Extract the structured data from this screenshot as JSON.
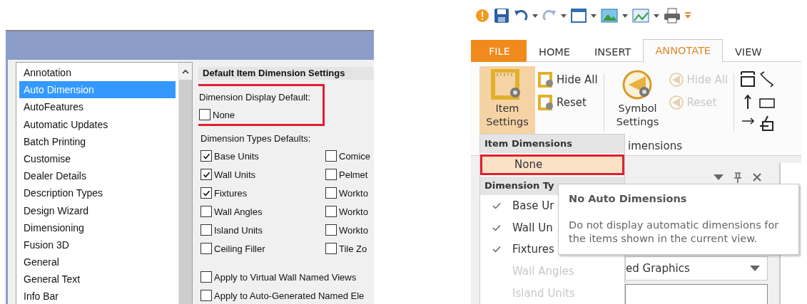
{
  "options_dialog": {
    "categories": [
      {
        "label": "Annotation",
        "selected": false
      },
      {
        "label": "Auto Dimension",
        "selected": true
      },
      {
        "label": "AutoFeatures",
        "selected": false
      },
      {
        "label": "Automatic Updates",
        "selected": false
      },
      {
        "label": "Batch Printing",
        "selected": false
      },
      {
        "label": "Customise",
        "selected": false
      },
      {
        "label": "Dealer Details",
        "selected": false
      },
      {
        "label": "Description Types",
        "selected": false
      },
      {
        "label": "Design Wizard",
        "selected": false
      },
      {
        "label": "Dimensioning",
        "selected": false
      },
      {
        "label": "Fusion 3D",
        "selected": false
      },
      {
        "label": "General",
        "selected": false
      },
      {
        "label": "General Text",
        "selected": false
      },
      {
        "label": "Info Bar",
        "selected": false
      }
    ],
    "section_title": "Default Item Dimension Settings",
    "display_default": {
      "label": "Dimension Display Default:",
      "highlighted": true,
      "option": {
        "label": "None",
        "checked": false
      }
    },
    "types_label": "Dimension Types Defaults:",
    "types": [
      {
        "label": "Base Units",
        "checked": true
      },
      {
        "label": "Comice",
        "checked": false
      },
      {
        "label": "Wall Units",
        "checked": true
      },
      {
        "label": "Pelmet",
        "checked": false
      },
      {
        "label": "Fixtures",
        "checked": true
      },
      {
        "label": "Workto",
        "checked": false
      },
      {
        "label": "Wall Angles",
        "checked": false
      },
      {
        "label": "Workto",
        "checked": false
      },
      {
        "label": "Island Units",
        "checked": false
      },
      {
        "label": "Workto",
        "checked": false
      },
      {
        "label": "Ceiling Filler",
        "checked": false
      },
      {
        "label": "Tile Zo",
        "checked": false
      }
    ],
    "apply_options": [
      {
        "label": "Apply to Virtual Wall Named Views",
        "checked": false
      },
      {
        "label": "Apply to Auto-Generated Named Ele",
        "checked": false
      }
    ]
  },
  "ribbon": {
    "tabs": [
      {
        "label": "FILE",
        "kind": "file",
        "selected": false
      },
      {
        "label": "HOME",
        "kind": "tab",
        "selected": false
      },
      {
        "label": "INSERT",
        "kind": "tab",
        "selected": false
      },
      {
        "label": "ANNOTATE",
        "kind": "tab",
        "selected": true
      },
      {
        "label": "VIEW",
        "kind": "tab",
        "selected": false
      }
    ],
    "item_settings": {
      "label": "Item Settings",
      "active": true
    },
    "item_buttons": [
      {
        "label": "Hide All",
        "disabled": false
      },
      {
        "label": "Reset",
        "disabled": false
      }
    ],
    "symbol_settings": {
      "label": "Symbol Settings",
      "active": false
    },
    "symbol_buttons": [
      {
        "label": "Hide All",
        "disabled": true
      },
      {
        "label": "Reset",
        "disabled": true
      }
    ],
    "group_label": "imensions",
    "menu": [
      {
        "kind": "header",
        "label": "Item Dimensions"
      },
      {
        "kind": "item",
        "label": "None",
        "checked": false,
        "disabled": false,
        "highlighted": true
      },
      {
        "kind": "header",
        "label": "Dimension Ty"
      },
      {
        "kind": "item",
        "label": "Base Ur",
        "checked": true,
        "disabled": false,
        "highlighted": false
      },
      {
        "kind": "item",
        "label": "Wall Un",
        "checked": true,
        "disabled": false,
        "highlighted": false
      },
      {
        "kind": "item",
        "label": "Fixtures",
        "checked": true,
        "disabled": false,
        "highlighted": false
      },
      {
        "kind": "item",
        "label": "Wall Angles",
        "checked": false,
        "disabled": true,
        "highlighted": false
      },
      {
        "kind": "item",
        "label": "Island Units",
        "checked": false,
        "disabled": true,
        "highlighted": false
      }
    ],
    "pane_dropdown": "ed Graphics",
    "tooltip": {
      "title": "No Auto Dimensions",
      "text": "Do not display automatic dimensions for the items shown in the current view."
    }
  }
}
